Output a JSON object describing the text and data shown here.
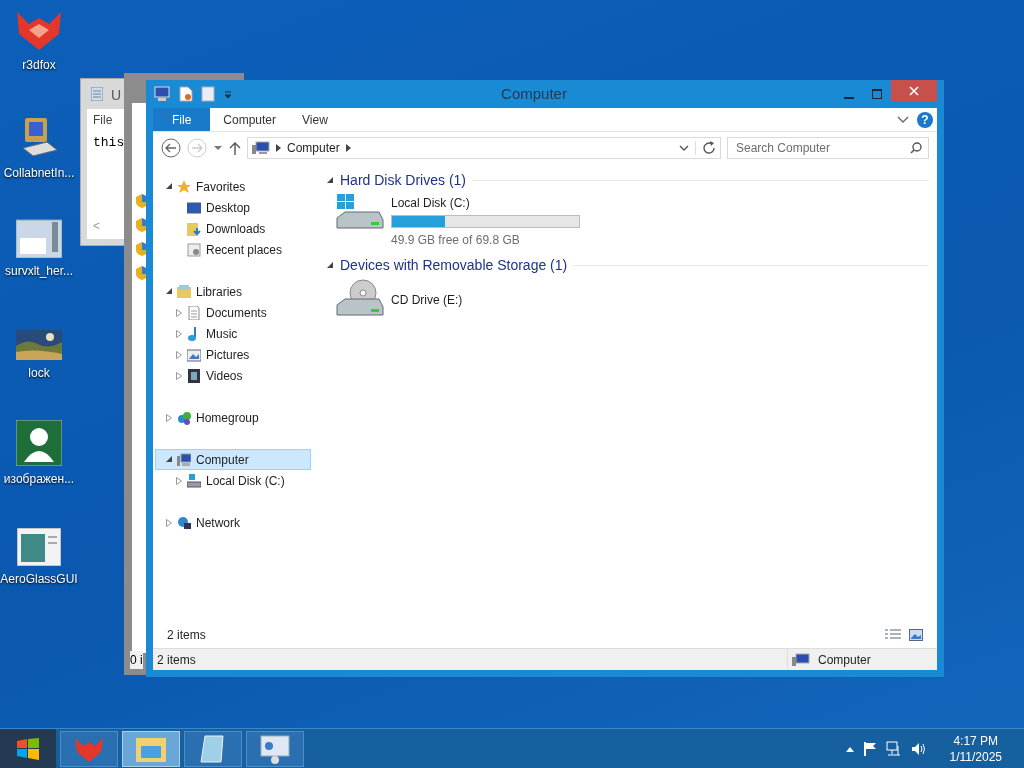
{
  "desktop_icons": [
    {
      "kind": "fox",
      "label": "r3dfox"
    },
    {
      "kind": "computer",
      "label": "CollabnetIn..."
    },
    {
      "kind": "document",
      "label": "survxlt_her..."
    },
    {
      "label": "lock"
    },
    {
      "kind": "user",
      "label": "изображен..."
    },
    {
      "kind": "app",
      "label": "AeroGlassGUI"
    }
  ],
  "notepad_window": {
    "title": "U",
    "menu": "File",
    "text": "this",
    "scroll_arrow": "<"
  },
  "back_window": {
    "status": "0 i"
  },
  "explorer": {
    "title": "Computer",
    "ribbon_tabs": [
      {
        "label": "File",
        "selected": true
      },
      {
        "label": "Computer",
        "selected": false
      },
      {
        "label": "View",
        "selected": false
      }
    ],
    "help": "?",
    "address": [
      "Computer"
    ],
    "search": {
      "placeholder": "Search Computer"
    },
    "nav": [
      {
        "label": "Favorites",
        "kind": "star",
        "expanded": true,
        "selected": false,
        "children": [
          {
            "label": "Desktop",
            "kind": "desktop",
            "selected": false
          },
          {
            "label": "Downloads",
            "kind": "downloads",
            "selected": false
          },
          {
            "label": "Recent places",
            "kind": "recent",
            "selected": false
          }
        ]
      },
      {
        "label": "Libraries",
        "kind": "library",
        "expanded": true,
        "selected": false,
        "children": [
          {
            "label": "Documents",
            "kind": "documents",
            "expanded": false,
            "selected": false
          },
          {
            "label": "Music",
            "kind": "music",
            "expanded": false,
            "selected": false
          },
          {
            "label": "Pictures",
            "kind": "pictures",
            "expanded": false,
            "selected": false
          },
          {
            "label": "Videos",
            "kind": "videos",
            "expanded": false,
            "selected": false
          }
        ]
      },
      {
        "label": "Homegroup",
        "kind": "homegroup",
        "expanded": false,
        "selected": false
      },
      {
        "label": "Computer",
        "kind": "computer",
        "expanded": true,
        "selected": true,
        "children": [
          {
            "label": "Local Disk (C:)",
            "kind": "disk",
            "expanded": false,
            "selected": false
          }
        ]
      },
      {
        "label": "Network",
        "kind": "network",
        "expanded": false,
        "selected": false
      }
    ],
    "sections": [
      {
        "heading": "Hard Disk Drives (1)",
        "items": [
          {
            "kind": "disk",
            "name": "Local Disk (C:)",
            "level": 0.285,
            "caption": "49.9 GB free of 69.8 GB"
          }
        ]
      },
      {
        "heading": "Devices with Removable Storage (1)",
        "items": [
          {
            "kind": "cd",
            "name": "CD Drive (E:)"
          }
        ]
      }
    ],
    "item_count": "2 items",
    "status_bar": {
      "count": "2 items",
      "location": "Computer"
    }
  },
  "taskbar": {
    "buttons": [
      {
        "kind": "fox",
        "selected": false
      },
      {
        "kind": "explorer",
        "selected": true
      },
      {
        "kind": "notepad",
        "selected": false
      },
      {
        "kind": "control",
        "selected": false
      }
    ],
    "time": "4:17 PM",
    "date": "1/11/2025"
  }
}
